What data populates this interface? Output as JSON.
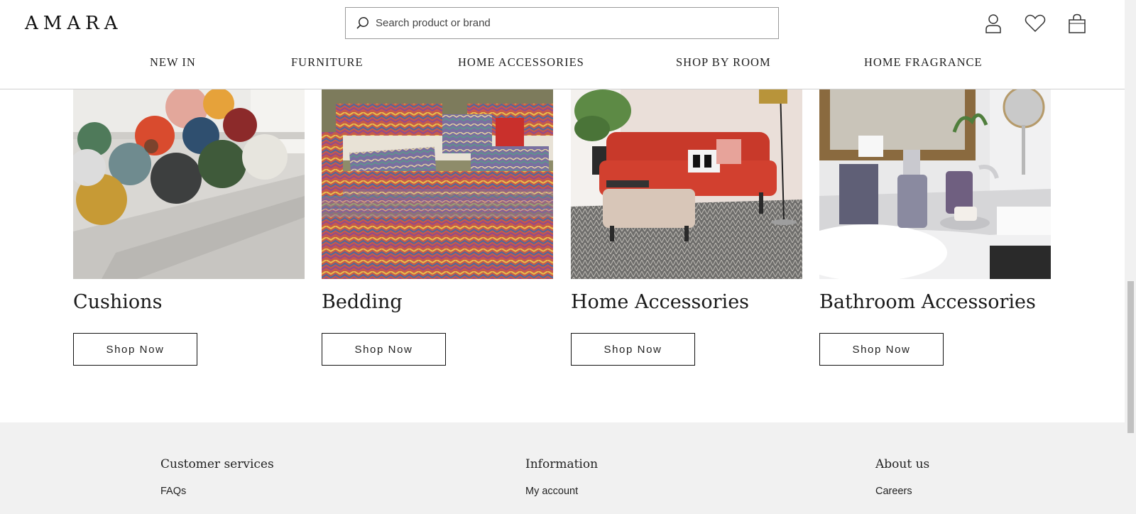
{
  "header": {
    "logo": "AMARA",
    "search": {
      "placeholder": "Search product or brand",
      "value": ""
    },
    "icons": [
      "account-icon",
      "wishlist-heart-icon",
      "shopping-bag-icon"
    ]
  },
  "nav": {
    "items": [
      {
        "label": "NEW IN"
      },
      {
        "label": "FURNITURE"
      },
      {
        "label": "HOME ACCESSORIES"
      },
      {
        "label": "SHOP BY ROOM"
      },
      {
        "label": "HOME FRAGRANCE"
      }
    ]
  },
  "categories": [
    {
      "title": "Cushions",
      "button": "Shop Now"
    },
    {
      "title": "Bedding",
      "button": "Shop Now"
    },
    {
      "title": "Home Accessories",
      "button": "Shop Now"
    },
    {
      "title": "Bathroom Accessories",
      "button": "Shop Now"
    }
  ],
  "footer": {
    "columns": [
      {
        "heading": "Customer services",
        "links": [
          "FAQs"
        ]
      },
      {
        "heading": "Information",
        "links": [
          "My account"
        ]
      },
      {
        "heading": "About us",
        "links": [
          "Careers"
        ]
      }
    ]
  },
  "colors": {
    "footer_bg": "#f1f1f1",
    "border": "#111111",
    "text": "#1a1a1a"
  }
}
